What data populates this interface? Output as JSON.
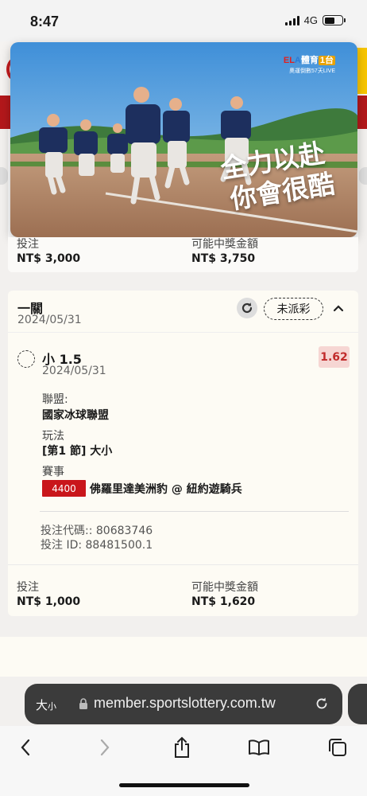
{
  "status_bar": {
    "time": "8:47",
    "network": "4G"
  },
  "video_ad": {
    "logo_main": [
      "EL",
      "A",
      "體育",
      "1台"
    ],
    "logo_sub": "奧運倒數57天LIVE",
    "slogan_line1": "全力以赴",
    "slogan_line2": "你會很酷",
    "colors": {
      "sky": "#6fb6e6",
      "field": "#b98a6a"
    }
  },
  "bet1": {
    "stake_label": "投注",
    "stake_value": "NT$ 3,000",
    "payout_label": "可能中獎金額",
    "payout_value": "NT$ 3,750"
  },
  "bet2": {
    "title": "一關",
    "date": "2024/05/31",
    "status": "未派彩",
    "selection": {
      "name": "小 1.5",
      "date": "2024/05/31",
      "odds": "1.62",
      "league_label": "聯盟:",
      "league_value": "國家冰球聯盟",
      "market_label": "玩法",
      "market_value": "[第1 節] 大小",
      "event_label": "賽事",
      "event_id": "4400",
      "event_name": "佛羅里達美洲豹 @ 紐約遊騎兵"
    },
    "bet_code": "投注代碼:: 80683746",
    "bet_id": "投注 ID: 88481500.1",
    "stake_label": "投注",
    "stake_value": "NT$ 1,000",
    "payout_label": "可能中獎金額",
    "payout_value": "NT$ 1,620"
  },
  "browser": {
    "text_size": "大",
    "text_size_small": "小",
    "url": "member.sportslottery.com.tw"
  },
  "colors": {
    "brand_red": "#b3181b",
    "odds_red": "#c12b2b",
    "event_red": "#c9161b"
  }
}
